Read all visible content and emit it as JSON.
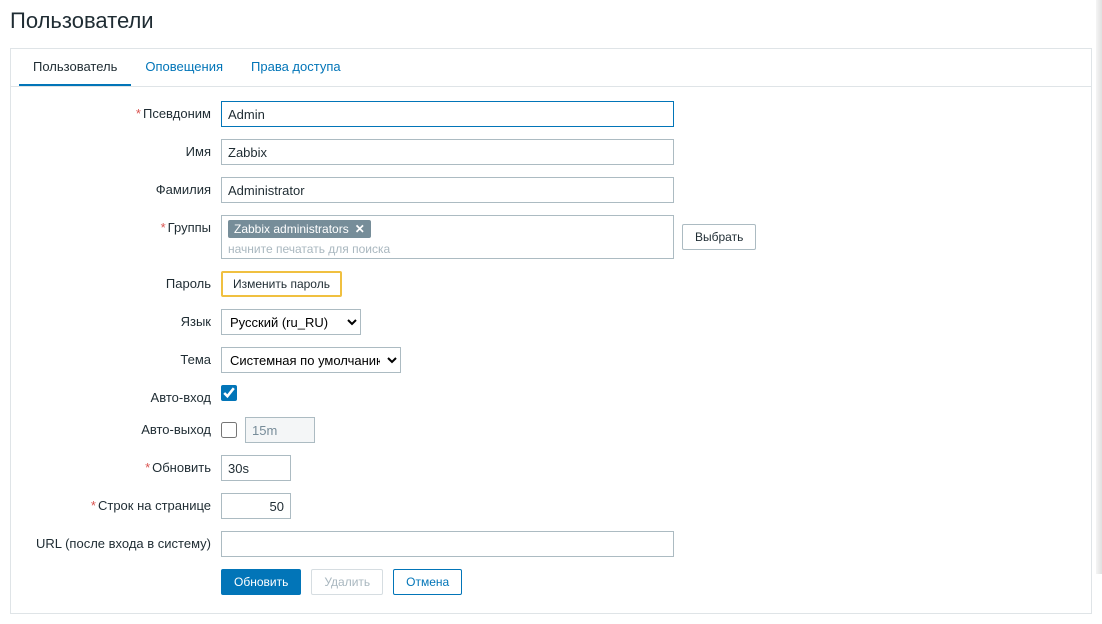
{
  "page": {
    "title": "Пользователи"
  },
  "tabs": {
    "user": "Пользователь",
    "media": "Оповещения",
    "permissions": "Права доступа"
  },
  "labels": {
    "alias": "Псевдоним",
    "name": "Имя",
    "surname": "Фамилия",
    "groups": "Группы",
    "password": "Пароль",
    "language": "Язык",
    "theme": "Тема",
    "autologin": "Авто-вход",
    "autologout": "Авто-выход",
    "refresh": "Обновить",
    "rows": "Строк на странице",
    "url": "URL (после входа в систему)"
  },
  "values": {
    "alias": "Admin",
    "name": "Zabbix",
    "surname": "Administrator",
    "url": "",
    "autologin": true,
    "autologout": false,
    "autologout_value": "15m",
    "refresh": "30s",
    "rows": "50"
  },
  "groups": {
    "chip": "Zabbix administrators",
    "placeholder": "начните печатать для поиска",
    "select_btn": "Выбрать"
  },
  "password_btn": "Изменить пароль",
  "selects": {
    "language": "Русский (ru_RU)",
    "theme": "Системная по умолчанию"
  },
  "buttons": {
    "update": "Обновить",
    "delete": "Удалить",
    "cancel": "Отмена"
  }
}
